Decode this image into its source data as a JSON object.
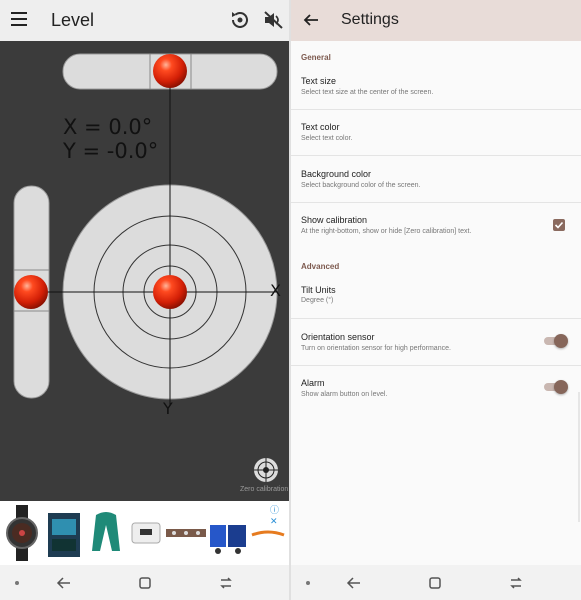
{
  "level_app": {
    "title": "Level",
    "icons": {
      "menu": "hamburger-menu-icon",
      "calibrate": "calibration-reset-icon",
      "sound": "sound-muted-icon"
    },
    "readout_x": "X = 0.0°",
    "readout_y": "Y = -0.0°",
    "axis_x_label": "X",
    "axis_y_label": "Y",
    "bubble_color": "#e02a10",
    "zero_calibration_label": "Zero calibration",
    "ad_badge": "ⓘ ✕"
  },
  "settings": {
    "title": "Settings",
    "categories": {
      "general": "General",
      "advanced": "Advanced"
    },
    "items": [
      {
        "title": "Text size",
        "summary": "Select text size at the center of the screen."
      },
      {
        "title": "Text color",
        "summary": "Select text color."
      },
      {
        "title": "Background color",
        "summary": "Select background color of the screen."
      },
      {
        "title": "Show calibration",
        "summary": "At the right-bottom, show or hide [Zero calibration] text.",
        "checked": true
      },
      {
        "title": "Tilt Units",
        "summary": "Degree (°)"
      },
      {
        "title": "Orientation sensor",
        "summary": "Turn on orientation sensor for high performance.",
        "enabled": true
      },
      {
        "title": "Alarm",
        "summary": "Show alarm button on level.",
        "enabled": true
      }
    ],
    "accent_color": "#86665a",
    "appbar_color": "#e8dcd8"
  }
}
